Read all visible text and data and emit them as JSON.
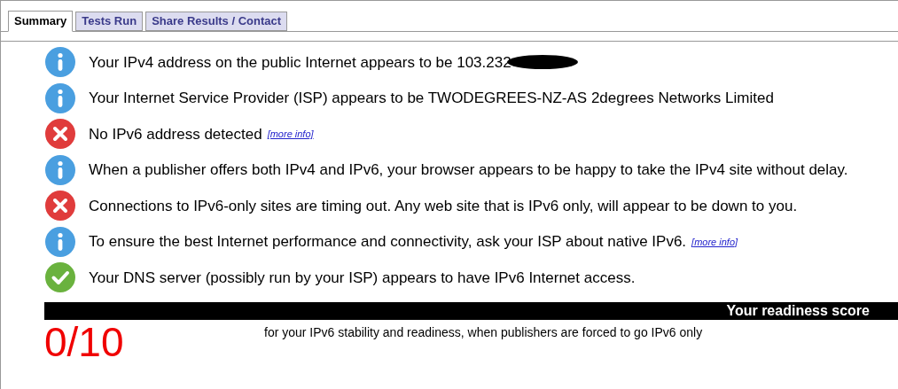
{
  "tabs": [
    {
      "label": "Summary",
      "selected": true
    },
    {
      "label": "Tests Run",
      "selected": false
    },
    {
      "label": "Share Results / Contact",
      "selected": false
    }
  ],
  "results": [
    {
      "kind": "info",
      "text": "Your IPv4 address on the public Internet appears to be 103.232",
      "redacted": true
    },
    {
      "kind": "info",
      "text": "Your Internet Service Provider (ISP) appears to be TWODEGREES-NZ-AS 2degrees Networks Limited"
    },
    {
      "kind": "error",
      "text": "No IPv6 address detected",
      "link": "[more info]"
    },
    {
      "kind": "info",
      "text": "When a publisher offers both IPv4 and IPv6, your browser appears to be happy to take the IPv4 site without delay."
    },
    {
      "kind": "error",
      "text": "Connections to IPv6-only sites are timing out. Any web site that is IPv6 only, will appear to be down to you."
    },
    {
      "kind": "info",
      "text": "To ensure the best Internet performance and connectivity, ask your ISP about native IPv6.",
      "link": "[more info]"
    },
    {
      "kind": "ok",
      "text": "Your DNS server (possibly run by your ISP) appears to have IPv6 Internet access."
    }
  ],
  "score": {
    "heading": "Your readiness score",
    "value": "0/10",
    "caption": "for your IPv6 stability and readiness, when publishers are forced to go IPv6 only"
  }
}
